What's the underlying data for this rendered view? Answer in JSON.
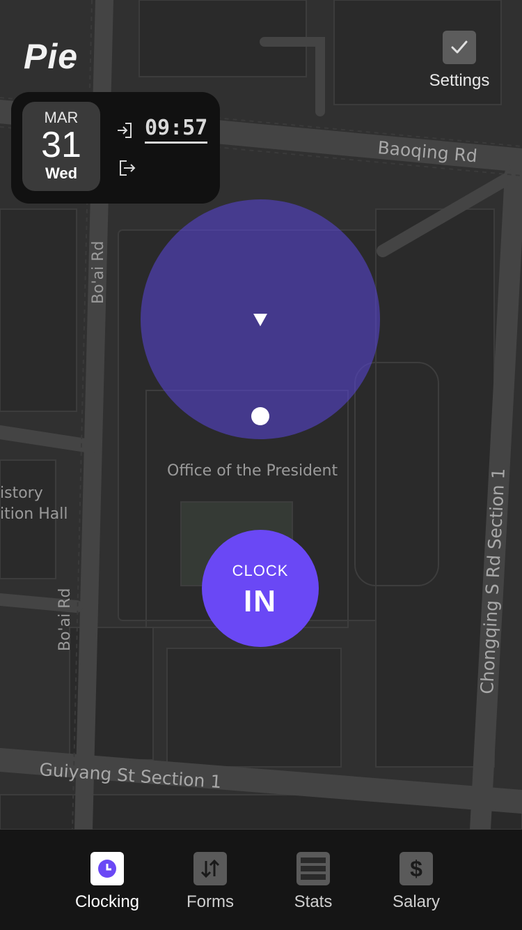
{
  "app": {
    "title": "Pie"
  },
  "settings": {
    "label": "Settings",
    "icon": "checkbox-icon"
  },
  "date_card": {
    "month": "MAR",
    "day": "31",
    "weekday": "Wed",
    "clock_in_time": "09:57",
    "icons": [
      "clock-in-icon",
      "clock-out-icon"
    ]
  },
  "map": {
    "labels": {
      "baoqing": "Baoqing Rd",
      "boai_top": "Bo'ai Rd",
      "boai_bottom": "Bo'ai Rd",
      "office": "Office of the President",
      "history_1": "istory",
      "history_2": "ition Hall",
      "chongqing": "Chongqing S Rd Section 1",
      "guiyang": "Guiyang St Section 1"
    }
  },
  "clock_button": {
    "line1": "CLOCK",
    "line2": "IN",
    "color": "#6a48f5"
  },
  "tabs": [
    {
      "label": "Clocking",
      "icon": "clock-icon",
      "active": true
    },
    {
      "label": "Forms",
      "icon": "swap-arrows-icon",
      "active": false
    },
    {
      "label": "Stats",
      "icon": "list-icon",
      "active": false
    },
    {
      "label": "Salary",
      "icon": "dollar-icon",
      "active": false
    }
  ],
  "colors": {
    "accent": "#6a48f5",
    "map_bg": "#303030",
    "tab_bar_bg": "#151515"
  }
}
